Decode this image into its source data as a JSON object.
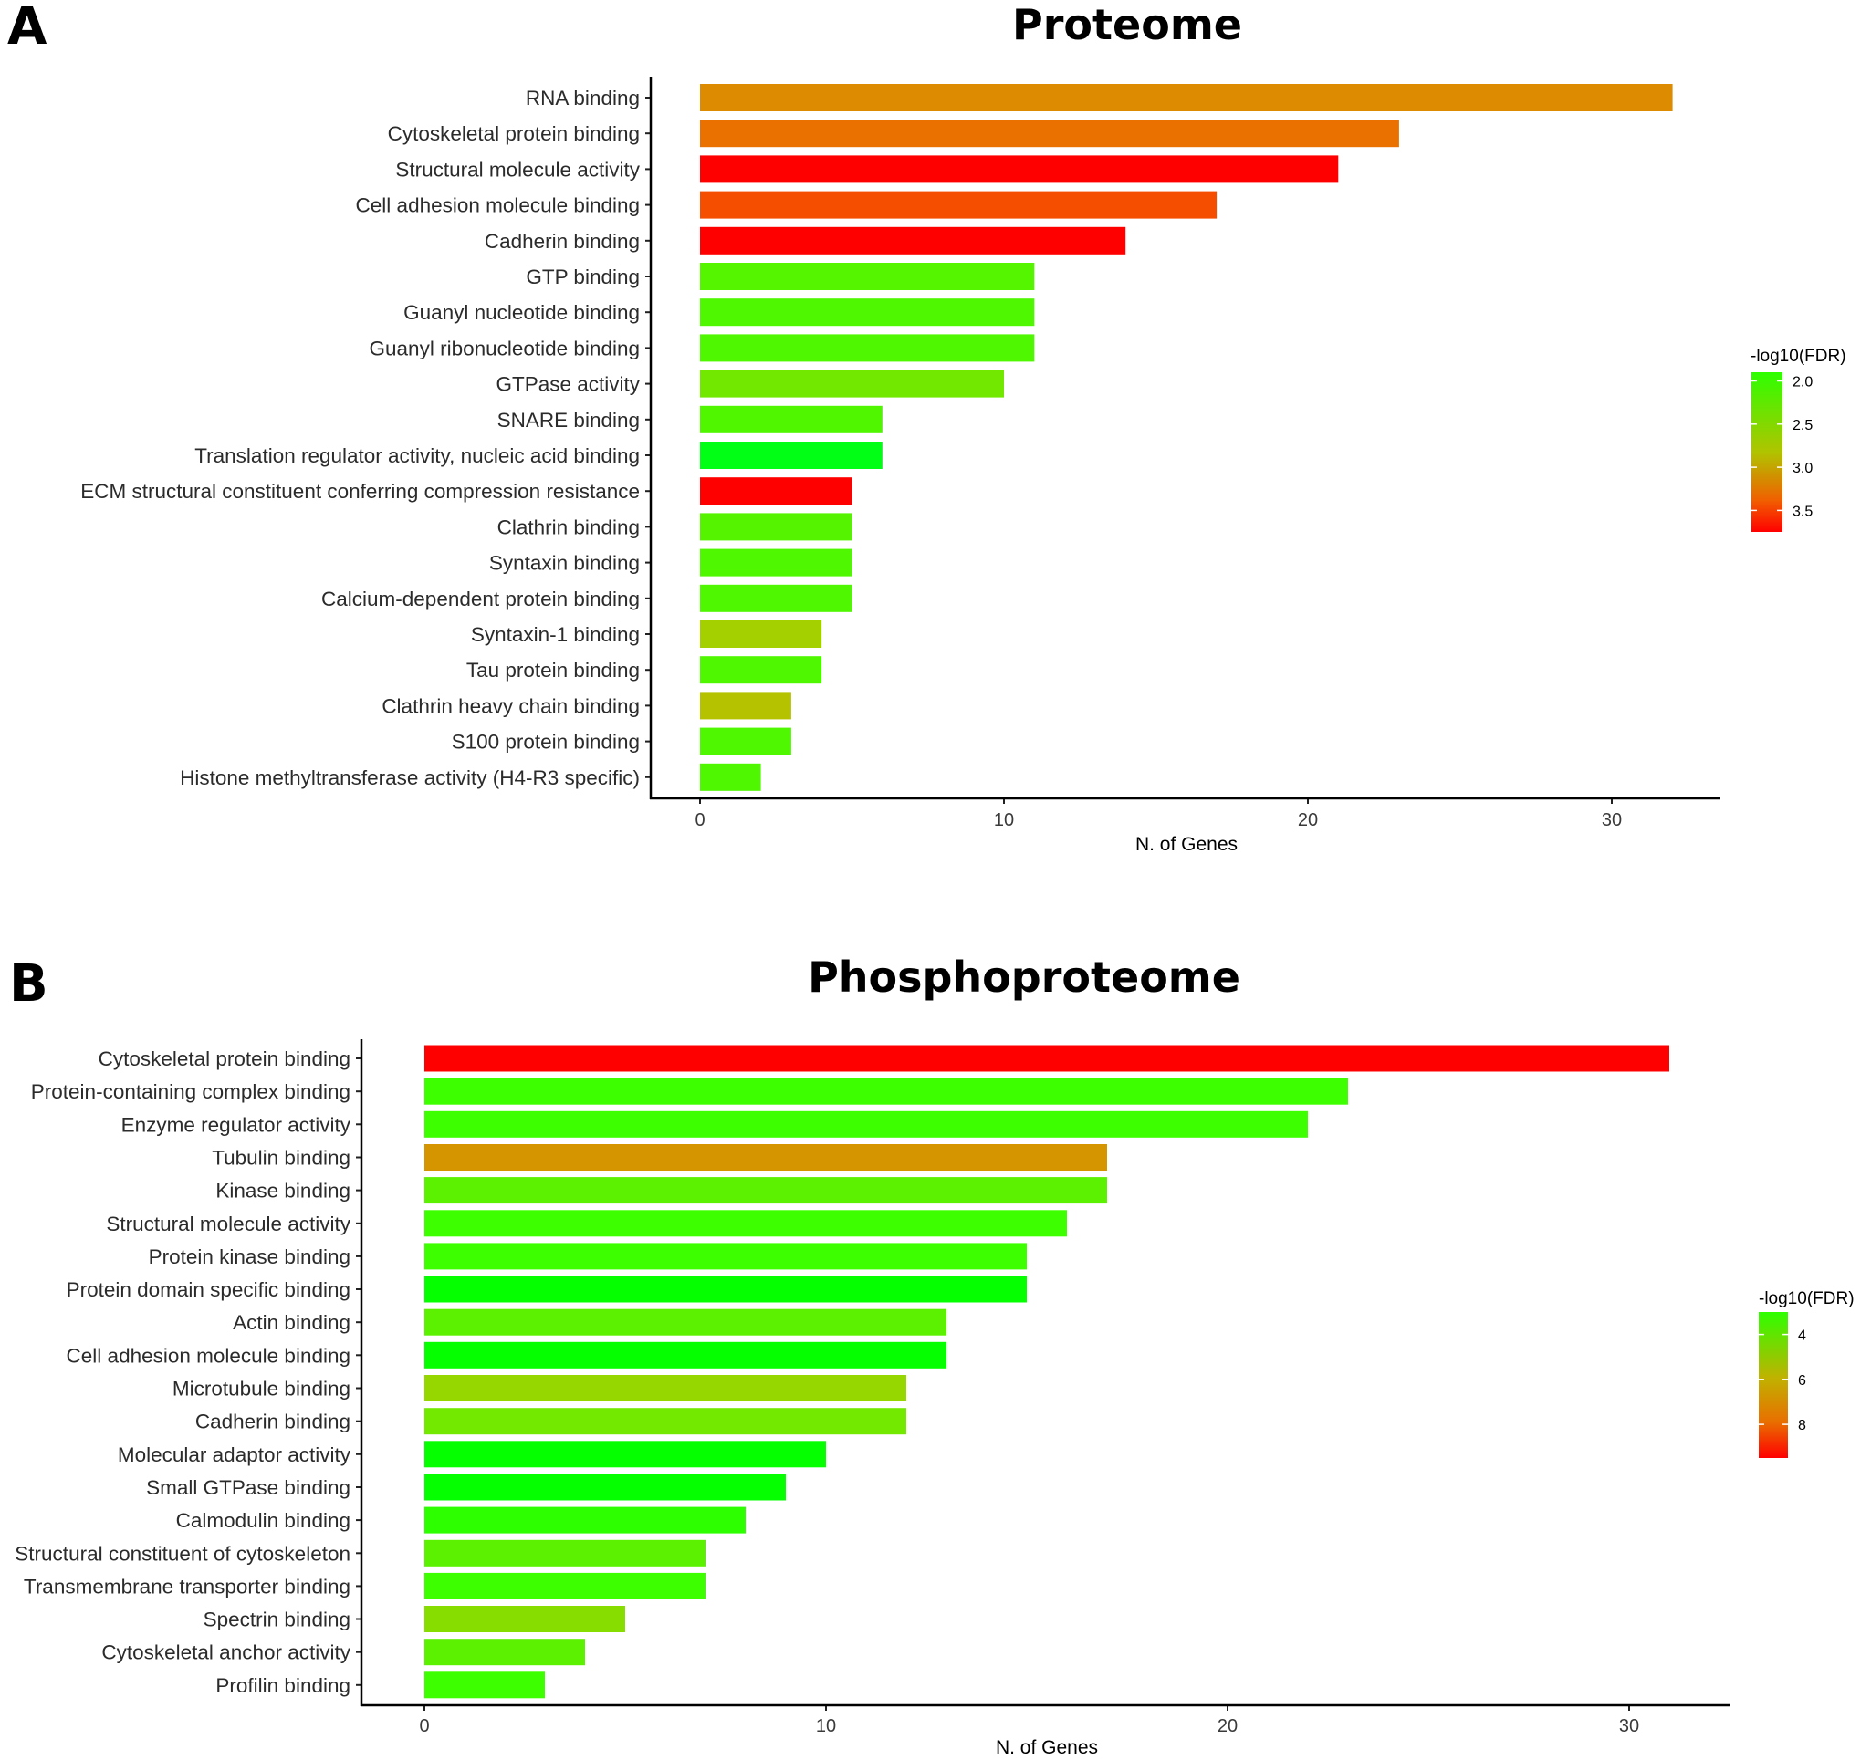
{
  "chart_data": [
    {
      "panel": "A",
      "type": "bar",
      "orientation": "horizontal",
      "title": "Proteome",
      "xlabel": "N. of Genes",
      "ylabel": "",
      "xlim": [
        0,
        33.5
      ],
      "xticks": [
        0,
        10,
        20,
        30
      ],
      "grid": false,
      "legend": {
        "title": "-log10(FDR)",
        "placement": "right",
        "type": "colorbar",
        "range": [
          1.9,
          3.75
        ],
        "ticks": [
          "2.0",
          "2.5",
          "3.0",
          "3.5"
        ],
        "tick_values": [
          2.0,
          2.5,
          3.0,
          3.5
        ],
        "low_color": "#2eff00",
        "mid_color": "#b5c200",
        "high_color": "#ff0000"
      },
      "categories": [
        "RNA binding",
        "Cytoskeletal protein binding",
        "Structural molecule activity",
        "Cell adhesion molecule binding",
        "Cadherin binding",
        "GTP binding",
        "Guanyl nucleotide binding",
        "Guanyl ribonucleotide binding",
        "GTPase activity",
        "SNARE binding",
        "Translation regulator activity, nucleic acid binding",
        "ECM structural constituent conferring compression resistance",
        "Clathrin binding",
        "Syntaxin binding",
        "Calcium-dependent protein binding",
        "Syntaxin-1 binding",
        "Tau protein binding",
        "Clathrin heavy chain binding",
        "S100 protein binding",
        "Histone methyltransferase activity (H4-R3 specific)"
      ],
      "values": [
        32,
        23,
        21,
        17,
        14,
        11,
        11,
        11,
        10,
        6,
        6,
        5,
        5,
        5,
        5,
        4,
        4,
        3,
        3,
        2
      ],
      "neg_log10_fdr": [
        3.1,
        3.3,
        3.75,
        3.5,
        3.75,
        2.1,
        2.05,
        2.05,
        2.3,
        2.05,
        1.9,
        3.75,
        2.1,
        2.05,
        2.05,
        2.65,
        2.05,
        2.75,
        2.05,
        2.05
      ],
      "colors": [
        "#dd8b00",
        "#ea7000",
        "#ff0000",
        "#f54e00",
        "#ff0000",
        "#55f500",
        "#4ff700",
        "#4ff700",
        "#72e800",
        "#50f600",
        "#00ff14",
        "#ff0000",
        "#55f300",
        "#4ff700",
        "#4ff700",
        "#a4d000",
        "#4ff700",
        "#b5c200",
        "#4ff700",
        "#4ff700"
      ]
    },
    {
      "panel": "B",
      "type": "bar",
      "orientation": "horizontal",
      "title": "Phosphoproteome",
      "xlabel": "N. of Genes",
      "ylabel": "",
      "xlim": [
        0,
        32.5
      ],
      "xticks": [
        0,
        10,
        20,
        30
      ],
      "grid": false,
      "legend": {
        "title": "-log10(FDR)",
        "placement": "right",
        "type": "colorbar",
        "range": [
          3.0,
          9.5
        ],
        "ticks": [
          "4",
          "6",
          "8"
        ],
        "tick_values": [
          4,
          6,
          8
        ],
        "low_color": "#06ff00",
        "mid_color": "#c9a000",
        "high_color": "#ff0000"
      },
      "categories": [
        "Cytoskeletal protein binding",
        "Protein-containing complex binding",
        "Enzyme regulator activity",
        "Tubulin binding",
        "Kinase binding",
        "Structural molecule activity",
        "Protein kinase binding",
        "Protein domain specific binding",
        "Actin binding",
        "Cell adhesion molecule binding",
        "Microtubule binding",
        "Cadherin binding",
        "Molecular adaptor activity",
        "Small GTPase binding",
        "Calmodulin binding",
        "Structural constituent of cytoskeleton",
        "Transmembrane transporter binding",
        "Spectrin binding",
        "Cytoskeletal anchor activity",
        "Profilin binding"
      ],
      "values": [
        31,
        23,
        22,
        17,
        17,
        16,
        15,
        15,
        13,
        13,
        12,
        12,
        10,
        9,
        8,
        7,
        7,
        5,
        4,
        3
      ],
      "neg_log10_fdr": [
        9.5,
        3.5,
        3.5,
        7.0,
        4.2,
        3.5,
        3.5,
        3.0,
        4.2,
        3.0,
        5.0,
        4.5,
        3.0,
        3.0,
        3.3,
        4.2,
        3.5,
        4.8,
        4.2,
        3.5
      ],
      "colors": [
        "#ff0000",
        "#3dff00",
        "#3dff00",
        "#d59500",
        "#5cf100",
        "#3dff00",
        "#3dff00",
        "#06ff00",
        "#5cf100",
        "#06ff00",
        "#97d700",
        "#73e900",
        "#06ff00",
        "#06ff00",
        "#2eff00",
        "#5cf100",
        "#3dff00",
        "#88dd00",
        "#5cf100",
        "#3dff00"
      ]
    }
  ]
}
